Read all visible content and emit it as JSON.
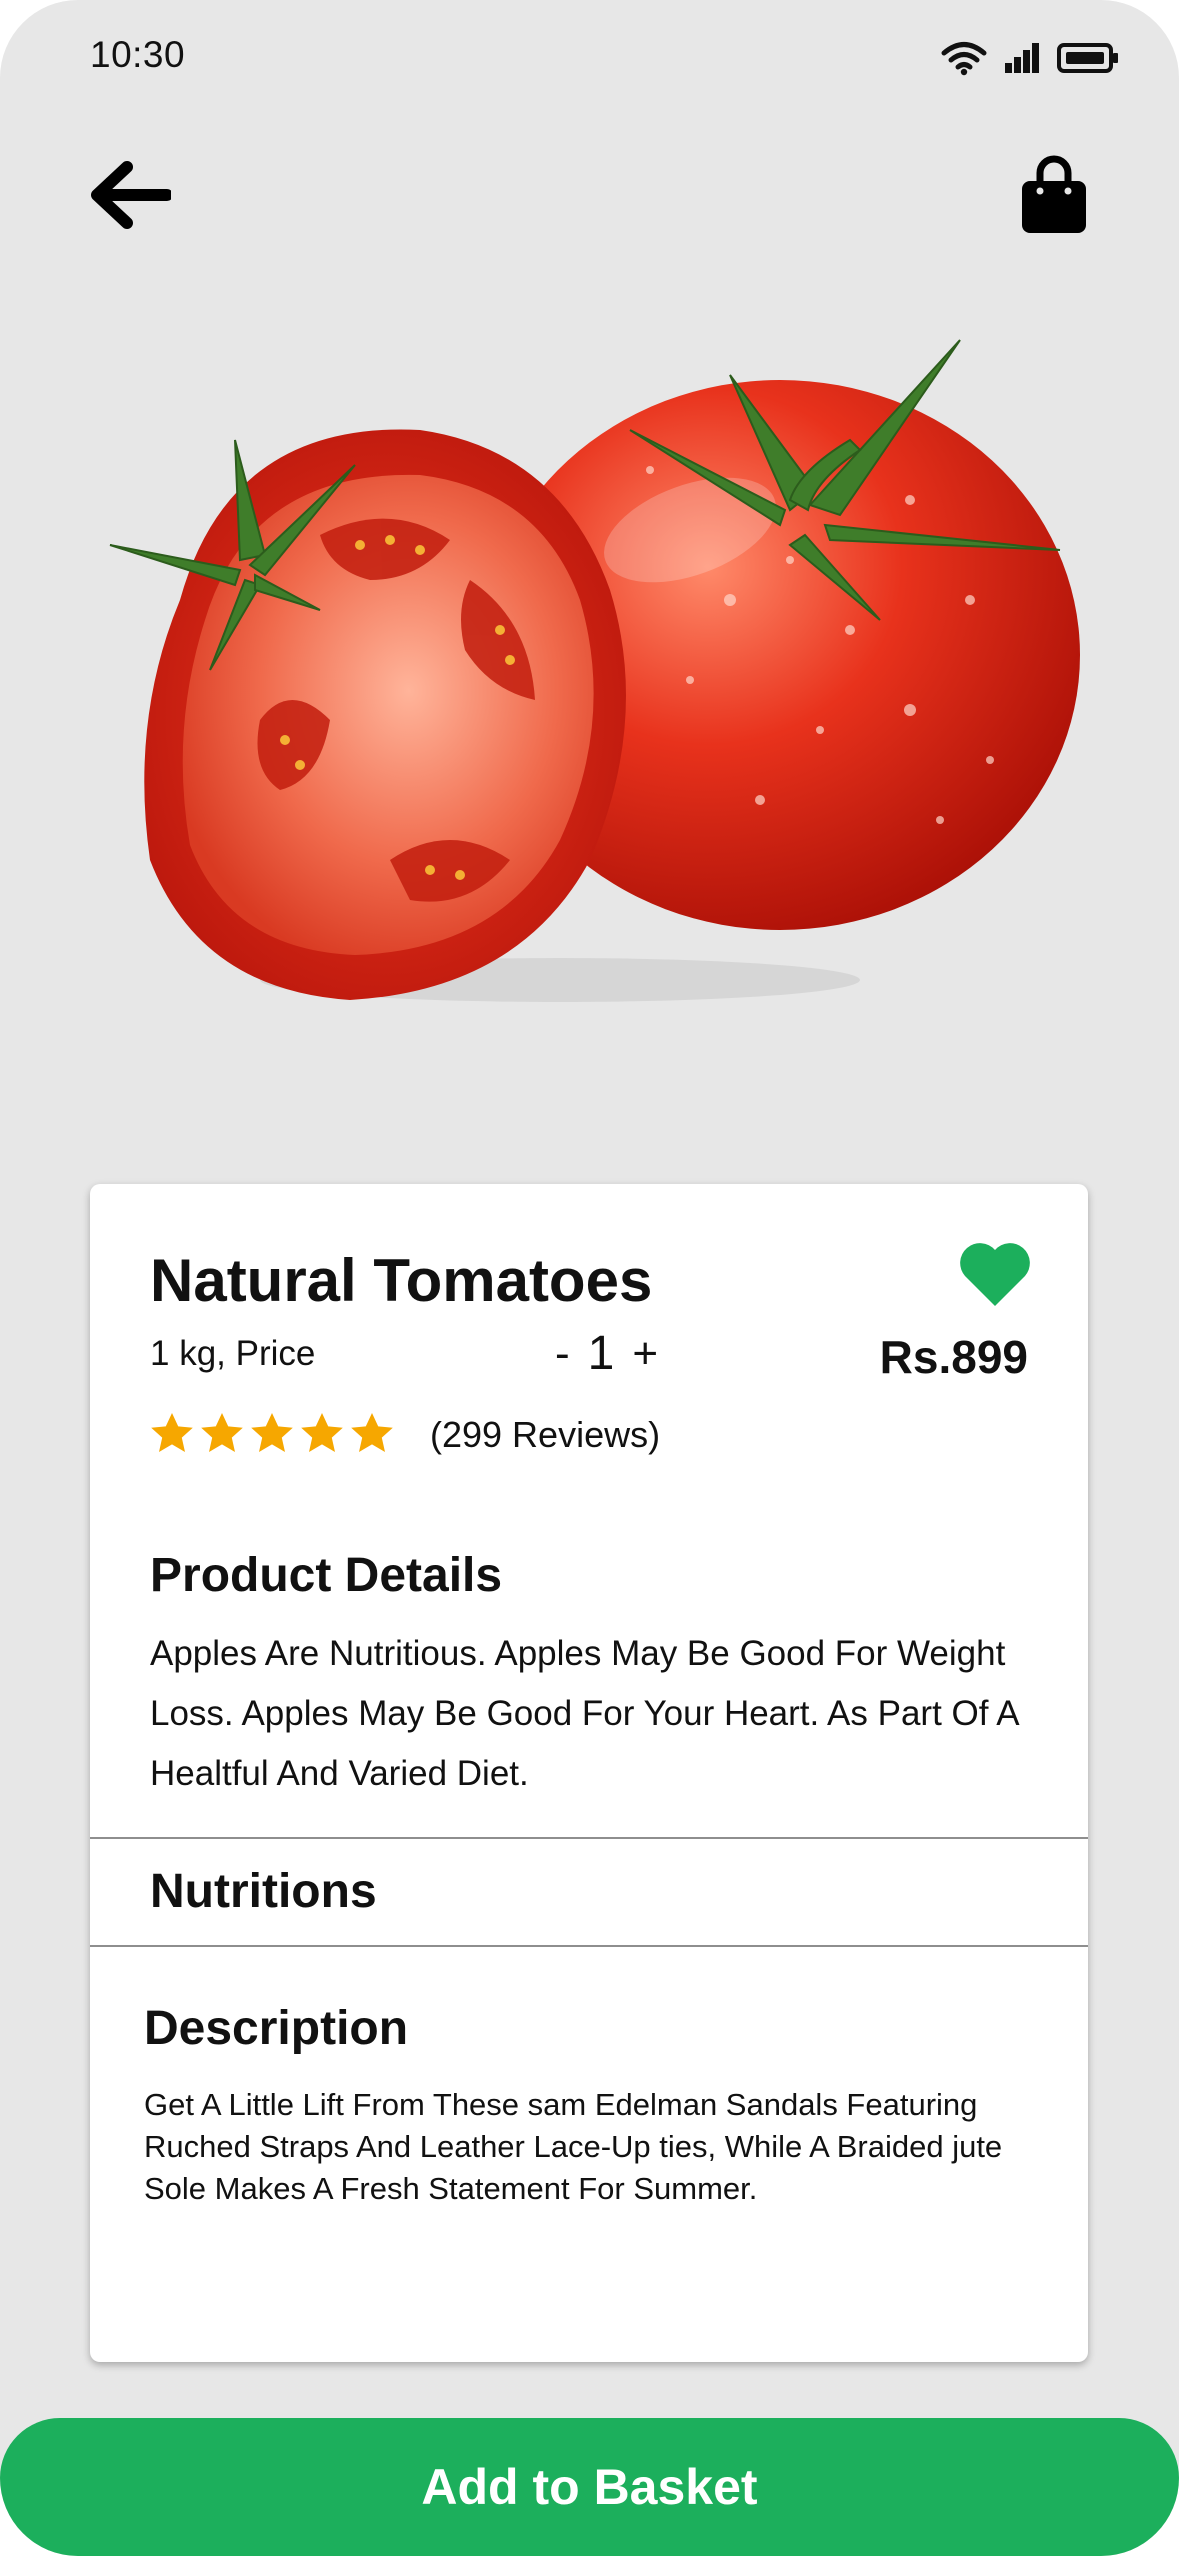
{
  "status_bar": {
    "time": "10:30",
    "icons": [
      "wifi-icon",
      "signal-icon",
      "battery-icon"
    ]
  },
  "nav": {
    "back_icon": "arrow-left-icon",
    "bag_icon": "shopping-bag-icon"
  },
  "product": {
    "image": "tomatoes-image",
    "name": "Natural Tomatoes",
    "unit_label": "1 kg, Price",
    "quantity_minus": "-",
    "quantity": "1",
    "quantity_plus": "+",
    "price": "Rs.899",
    "favorite": true,
    "rating": 5,
    "reviews": "(299 Reviews)"
  },
  "details": {
    "heading": "Product Details",
    "text": "Apples Are Nutritious. Apples May Be Good For Weight Loss. Apples May Be Good For Your Heart. As Part Of A Healtful And Varied Diet."
  },
  "nutritions": {
    "heading": "Nutritions"
  },
  "description": {
    "heading": "Description",
    "text": "Get A Little Lift From These sam Edelman Sandals Featuring Ruched Straps And Leather Lace-Up ties, While A Braided jute Sole Makes A Fresh Statement For Summer."
  },
  "cta": {
    "label": "Add to Basket"
  },
  "colors": {
    "accent": "#1caf5c",
    "star": "#f6a700",
    "background": "#e7e7e7",
    "card": "#ffffff"
  }
}
